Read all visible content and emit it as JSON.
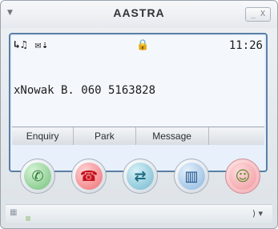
{
  "window": {
    "brand": "AASTRA",
    "menu_icon": "dropdown-arrow",
    "controls": "_ X"
  },
  "display": {
    "status_icons_left": "↳♫ ✉⇣",
    "lock_icon": "lock",
    "time": "11:26",
    "line": "xNowak B. 060 5163828",
    "softkeys": [
      "Enquiry",
      "Park",
      "Message",
      ""
    ]
  },
  "keys": {
    "answer": {
      "icon": "phone-answer",
      "glyph": "✆"
    },
    "hangup": {
      "icon": "phone-hangup",
      "glyph": "☎"
    },
    "transfer": {
      "icon": "transfer",
      "glyph": "⇄"
    },
    "phonebook": {
      "icon": "phonebook",
      "glyph": "▥"
    },
    "contacts": {
      "icon": "contact",
      "glyph": "☺"
    }
  },
  "bottom": {
    "keypad_icon": "keypad",
    "right_icons": ") ▾"
  },
  "colors": {
    "display_border": "#5a7fa6",
    "answer_green": "#75c17b",
    "hangup_red": "#ef6e74",
    "contact_pink": "#f1aaaf"
  }
}
